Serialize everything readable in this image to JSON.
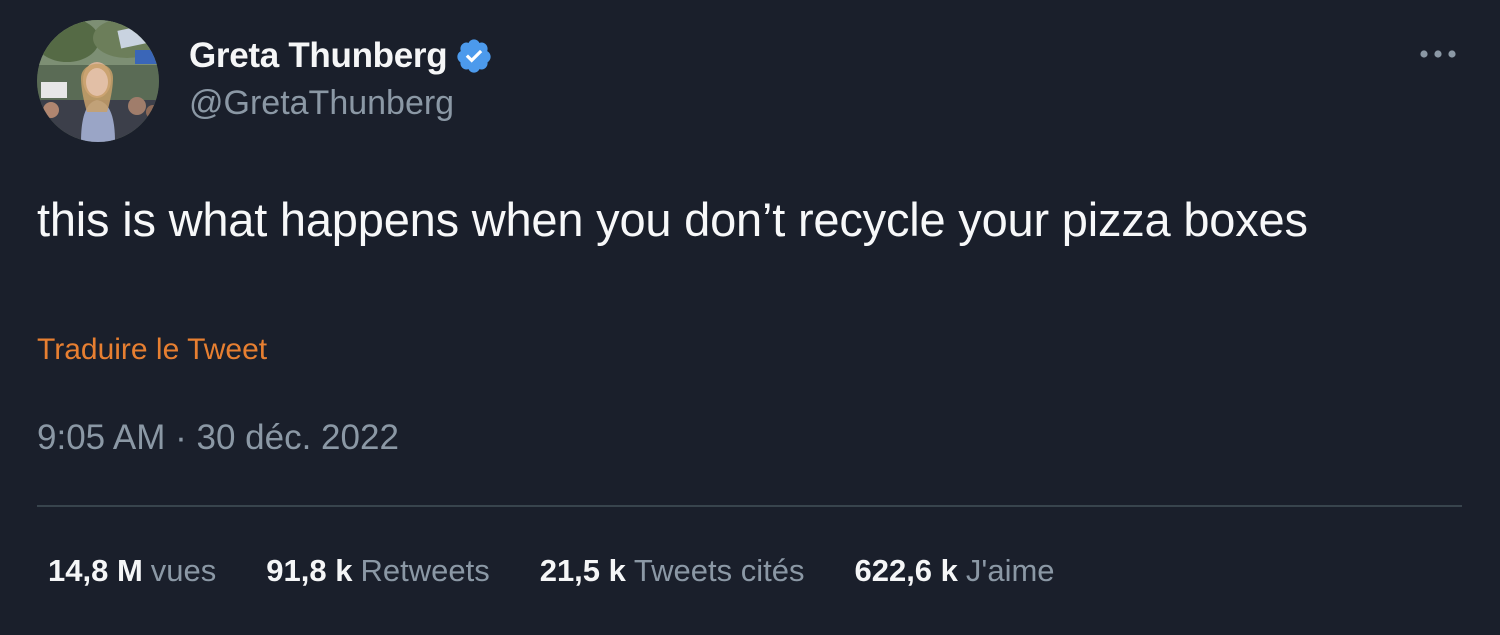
{
  "author": {
    "display_name": "Greta Thunberg",
    "handle": "@GretaThunberg",
    "verified": true
  },
  "tweet": {
    "text": "this is what happens when you don’t recycle your pizza boxes",
    "translate_label": "Traduire le Tweet",
    "timestamp": "9:05 AM · 30 déc. 2022"
  },
  "stats": {
    "views": {
      "count": "14,8 M",
      "label": "vues"
    },
    "retweets": {
      "count": "91,8 k",
      "label": "Retweets"
    },
    "quotes": {
      "count": "21,5 k",
      "label": "Tweets cités"
    },
    "likes": {
      "count": "622,6 k",
      "label": "J'aime"
    }
  },
  "colors": {
    "background": "#1a1f2b",
    "verified_badge": "#4c9aec",
    "translate_link": "#e77f31",
    "secondary_text": "#8b98a5"
  },
  "icons": {
    "verified": "verified-badge-icon",
    "more": "more-options-icon"
  }
}
